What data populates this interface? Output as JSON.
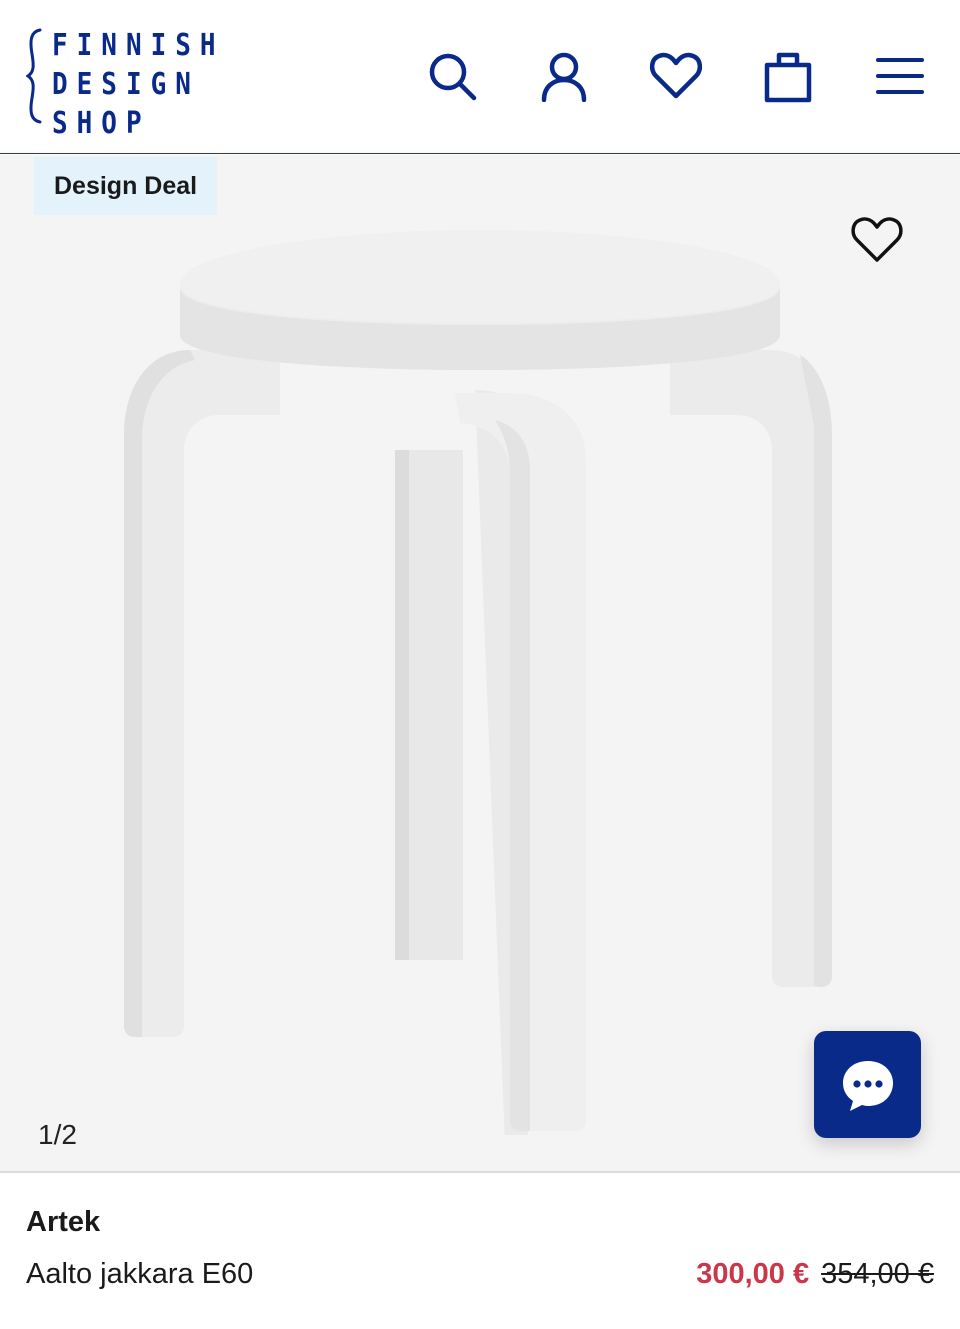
{
  "header": {
    "logo": {
      "lines": [
        "FINNISH",
        "DESIGN",
        "SHOP"
      ]
    },
    "icons": [
      "search-icon",
      "user-icon",
      "heart-icon",
      "bag-icon",
      "menu-icon"
    ],
    "accent_color": "#0a2a8a"
  },
  "hero": {
    "badge": "Design Deal",
    "counter": "1/2",
    "background": "#f4f4f4"
  },
  "product": {
    "brand": "Artek",
    "name": "Aalto jakkara E60",
    "sale_price": "300,00 €",
    "original_price": "354,00 €",
    "sale_color": "#c8374a"
  }
}
